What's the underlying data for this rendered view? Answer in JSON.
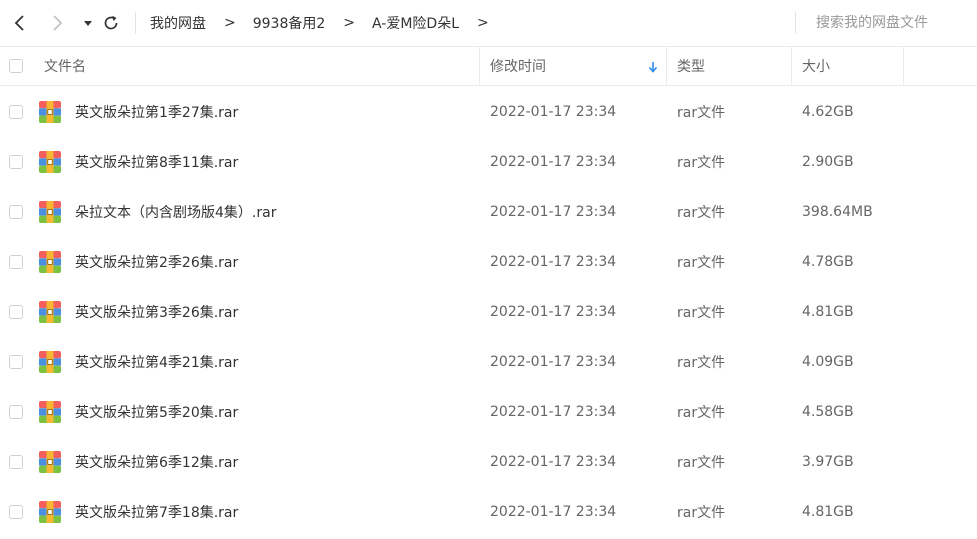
{
  "toolbar": {
    "back_icon": "chevron-left-icon",
    "forward_icon": "chevron-right-icon",
    "dropdown_icon": "caret-down-icon",
    "refresh_icon": "refresh-icon",
    "breadcrumbs": [
      "我的网盘",
      "9938备用2",
      "A-爱M险D朵L"
    ],
    "crumb_separator": ">",
    "search_placeholder": "搜索我的网盘文件"
  },
  "table": {
    "headers": {
      "name": "文件名",
      "modified": "修改时间",
      "type": "类型",
      "size": "大小"
    },
    "sort_indicator_icon": "arrow-down-icon",
    "accent_color": "#2e8ef0",
    "file_icon": "rar-archive-icon",
    "rows": [
      {
        "name": "英文版朵拉第1季27集.rar",
        "modified": "2022-01-17 23:34",
        "type": "rar文件",
        "size": "4.62GB"
      },
      {
        "name": "英文版朵拉第8季11集.rar",
        "modified": "2022-01-17 23:34",
        "type": "rar文件",
        "size": "2.90GB"
      },
      {
        "name": "朵拉文本（内含剧场版4集）.rar",
        "modified": "2022-01-17 23:34",
        "type": "rar文件",
        "size": "398.64MB"
      },
      {
        "name": "英文版朵拉第2季26集.rar",
        "modified": "2022-01-17 23:34",
        "type": "rar文件",
        "size": "4.78GB"
      },
      {
        "name": "英文版朵拉第3季26集.rar",
        "modified": "2022-01-17 23:34",
        "type": "rar文件",
        "size": "4.81GB"
      },
      {
        "name": "英文版朵拉第4季21集.rar",
        "modified": "2022-01-17 23:34",
        "type": "rar文件",
        "size": "4.09GB"
      },
      {
        "name": "英文版朵拉第5季20集.rar",
        "modified": "2022-01-17 23:34",
        "type": "rar文件",
        "size": "4.58GB"
      },
      {
        "name": "英文版朵拉第6季12集.rar",
        "modified": "2022-01-17 23:34",
        "type": "rar文件",
        "size": "3.97GB"
      },
      {
        "name": "英文版朵拉第7季18集.rar",
        "modified": "2022-01-17 23:34",
        "type": "rar文件",
        "size": "4.81GB"
      }
    ]
  }
}
